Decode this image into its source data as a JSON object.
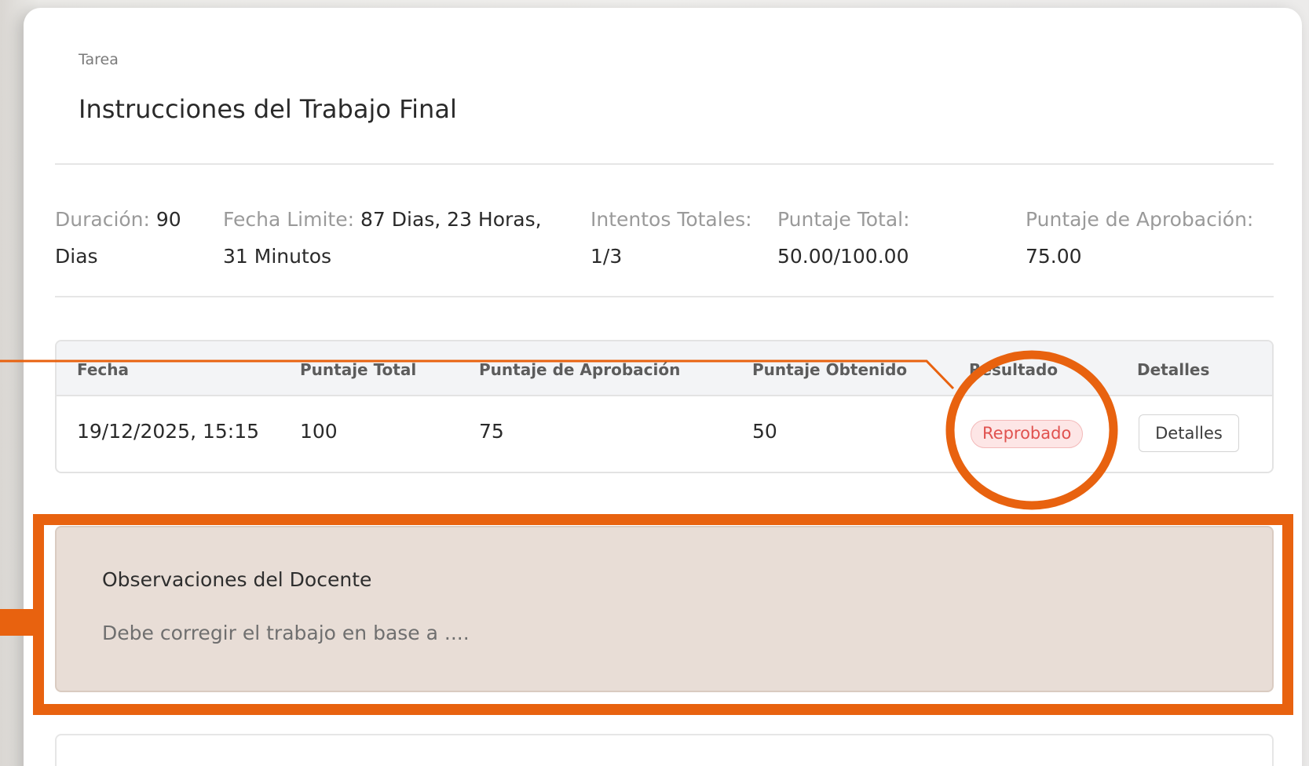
{
  "task": {
    "eyebrow": "Tarea",
    "title": "Instrucciones del Trabajo Final"
  },
  "stats": [
    {
      "label": "Duración:",
      "value": "90 Dias"
    },
    {
      "label": "Fecha Limite:",
      "value": "87 Dias, 23 Horas, 31 Minutos"
    },
    {
      "label": "Intentos Totales:",
      "value": "1/3"
    },
    {
      "label": "Puntaje Total:",
      "value": "50.00/100.00"
    },
    {
      "label": "Puntaje de Aprobación:",
      "value": "75.00"
    }
  ],
  "table": {
    "headers": [
      "Fecha",
      "Puntaje Total",
      "Puntaje de Aprobación",
      "Puntaje Obtenido",
      "Resultado",
      "Detalles"
    ],
    "rows": [
      {
        "fecha": "19/12/2025, 15:15",
        "puntaje_total": "100",
        "puntaje_aprobacion": "75",
        "puntaje_obtenido": "50",
        "resultado": "Reprobado",
        "detalles_button": "Detalles"
      }
    ]
  },
  "observations": {
    "title": "Observaciones del Docente",
    "text": "Debe corregir el trabajo en base a ...."
  },
  "colors": {
    "annotation": "#e8620f",
    "badge_text": "#e0524f",
    "badge_bg": "#fde6e6",
    "observation_bg": "#e8ddd6"
  }
}
